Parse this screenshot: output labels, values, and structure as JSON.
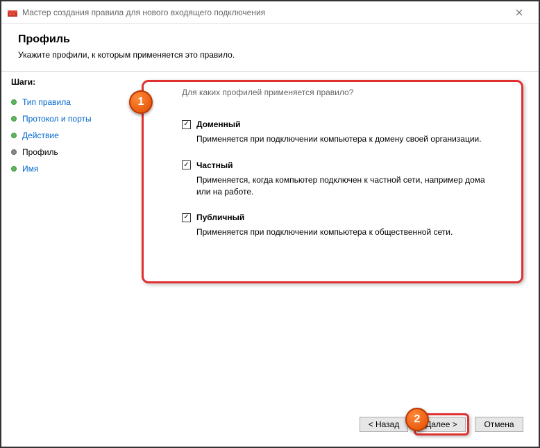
{
  "titlebar": {
    "text": "Мастер создания правила для нового входящего подключения"
  },
  "header": {
    "title": "Профиль",
    "subtitle": "Укажите профили, к которым применяется это правило."
  },
  "sidebar": {
    "label": "Шаги:",
    "steps": [
      {
        "label": "Тип правила"
      },
      {
        "label": "Протокол и порты"
      },
      {
        "label": "Действие"
      },
      {
        "label": "Профиль"
      },
      {
        "label": "Имя"
      }
    ]
  },
  "content": {
    "question": "Для каких профилей применяется правило?",
    "profiles": [
      {
        "label": "Доменный",
        "desc": "Применяется при подключении компьютера к домену своей организации."
      },
      {
        "label": "Частный",
        "desc": "Применяется, когда компьютер подключен к частной сети, например дома или на работе."
      },
      {
        "label": "Публичный",
        "desc": "Применяется при подключении компьютера к общественной сети."
      }
    ]
  },
  "footer": {
    "back": "< Назад",
    "next": "Далее >",
    "cancel": "Отмена"
  },
  "badges": {
    "b1": "1",
    "b2": "2"
  }
}
